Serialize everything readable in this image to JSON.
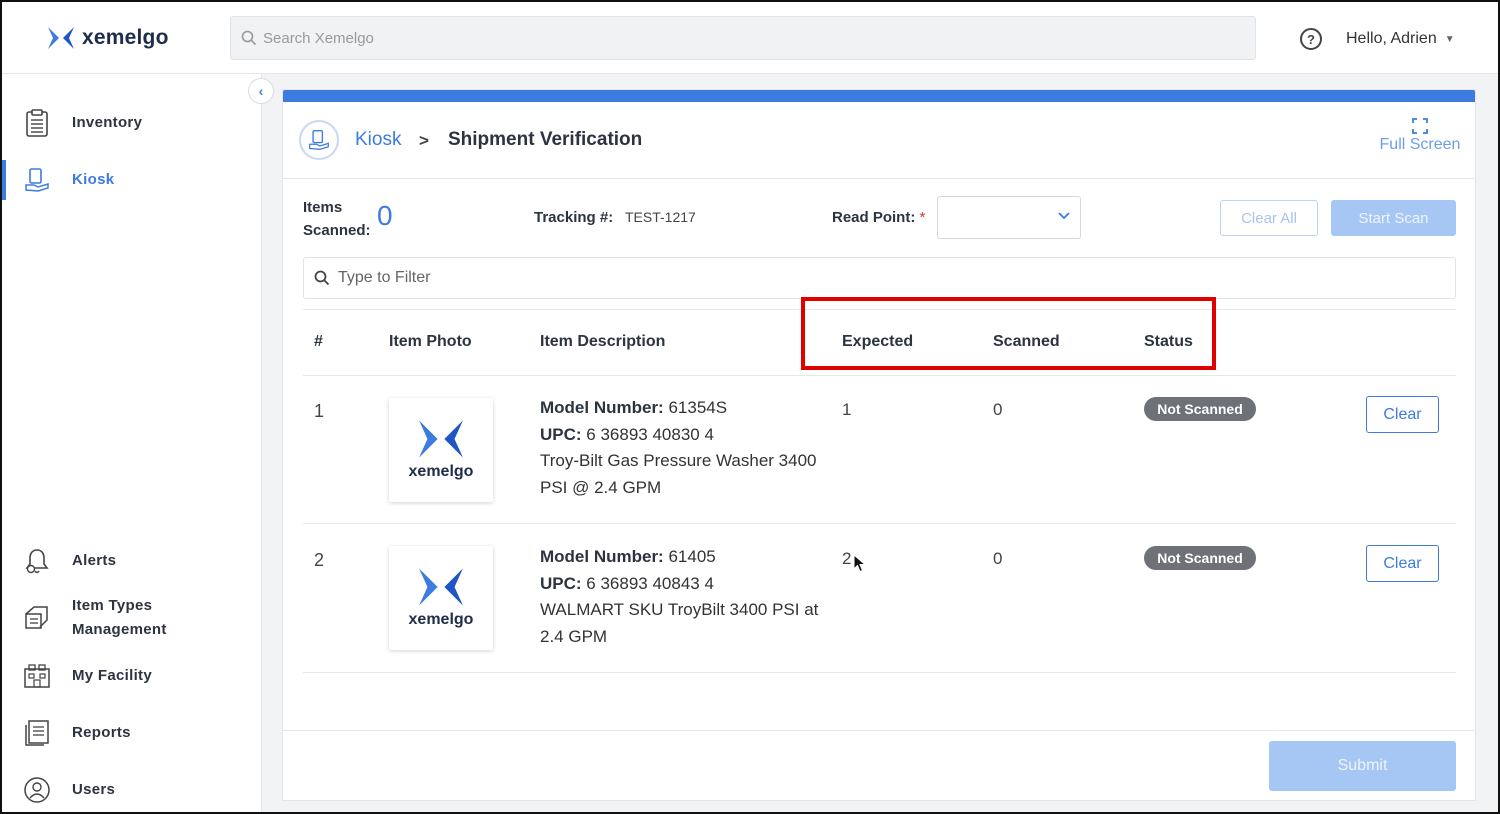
{
  "app": {
    "logo_text": "xemelgo",
    "search_placeholder": "Search Xemelgo",
    "help_icon": "help-circle-icon",
    "user_greeting": "Hello, Adrien"
  },
  "sidebar": {
    "items": [
      {
        "label": "Inventory",
        "icon": "clipboard-icon",
        "active": false
      },
      {
        "label": "Kiosk",
        "icon": "kiosk-icon",
        "active": true
      },
      {
        "label": "Alerts",
        "icon": "bell-icon",
        "active": false
      },
      {
        "label": "Item Types Management",
        "icon": "tags-icon",
        "active": false
      },
      {
        "label": "My Facility",
        "icon": "facility-icon",
        "active": false
      },
      {
        "label": "Reports",
        "icon": "report-icon",
        "active": false
      },
      {
        "label": "Users",
        "icon": "user-icon",
        "active": false
      }
    ]
  },
  "header": {
    "breadcrumb_root": "Kiosk",
    "breadcrumb_separator": ">",
    "page_title": "Shipment Verification",
    "fullscreen_label": "Full Screen"
  },
  "controls": {
    "items_scanned_label": "Items Scanned:",
    "items_scanned_value": "0",
    "tracking_label": "Tracking #:",
    "tracking_value": "TEST-1217",
    "read_point_label": "Read Point:",
    "read_point_required": "*",
    "read_point_value": "",
    "clear_all_label": "Clear All",
    "start_scan_label": "Start Scan",
    "filter_placeholder": "Type to Filter"
  },
  "table": {
    "columns": [
      "#",
      "Item Photo",
      "Item Description",
      "Expected",
      "Scanned",
      "Status"
    ],
    "rows": [
      {
        "num": "1",
        "photo_text": "xemelgo",
        "model_label": "Model Number:",
        "model_value": "61354S",
        "upc_label": "UPC:",
        "upc_value": "6 36893 40830 4",
        "description": "Troy-Bilt Gas Pressure Washer 3400 PSI @ 2.4 GPM",
        "expected": "1",
        "scanned": "0",
        "status": "Not Scanned",
        "clear_label": "Clear"
      },
      {
        "num": "2",
        "photo_text": "xemelgo",
        "model_label": "Model Number:",
        "model_value": "61405",
        "upc_label": "UPC:",
        "upc_value": "6 36893 40843 4",
        "description": "WALMART SKU TroyBilt 3400 PSI at 2.4 GPM",
        "expected": "2",
        "scanned": "0",
        "status": "Not Scanned",
        "clear_label": "Clear"
      }
    ]
  },
  "footer": {
    "submit_label": "Submit"
  },
  "colors": {
    "accent": "#3d7be0",
    "highlight": "#e00000",
    "badge": "#6e7177"
  }
}
